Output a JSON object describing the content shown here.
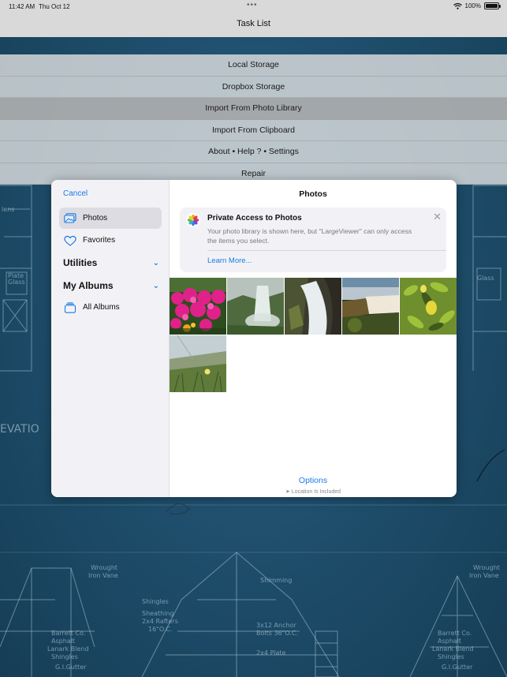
{
  "status_bar": {
    "time": "11:42 AM",
    "date": "Thu Oct 12",
    "battery": "100%",
    "wifi_icon": "wifi-icon",
    "battery_icon": "battery-icon"
  },
  "nav": {
    "title": "Task List"
  },
  "menu": {
    "items": [
      {
        "label": "Local Storage"
      },
      {
        "label": "Dropbox Storage"
      },
      {
        "label": "Import From Photo Library"
      },
      {
        "label": "Import From Clipboard"
      },
      {
        "label": "About • Help ? • Settings"
      },
      {
        "label": "Repair"
      }
    ],
    "selected_index": 2
  },
  "picker": {
    "cancel": "Cancel",
    "title": "Photos",
    "sidebar": {
      "photos": "Photos",
      "favorites": "Favorites",
      "utilities": "Utilities",
      "my_albums": "My Albums",
      "all_albums": "All Albums"
    },
    "notice": {
      "title": "Private Access to Photos",
      "body": "Your photo library is shown here, but \"LargeViewer\" can only access the items you select.",
      "link": "Learn More..."
    },
    "photos": [
      {
        "name": "pink-flowers-photo"
      },
      {
        "name": "waterfall-mist-photo"
      },
      {
        "name": "rocky-waterfall-photo"
      },
      {
        "name": "sunset-waterfall-photo"
      },
      {
        "name": "lemon-tree-photo"
      },
      {
        "name": "dune-plants-photo"
      }
    ],
    "options": "Options",
    "location": "Location Is Included"
  },
  "colors": {
    "accent": "#1a7ae6",
    "blueprint": "#1f4f6c"
  }
}
